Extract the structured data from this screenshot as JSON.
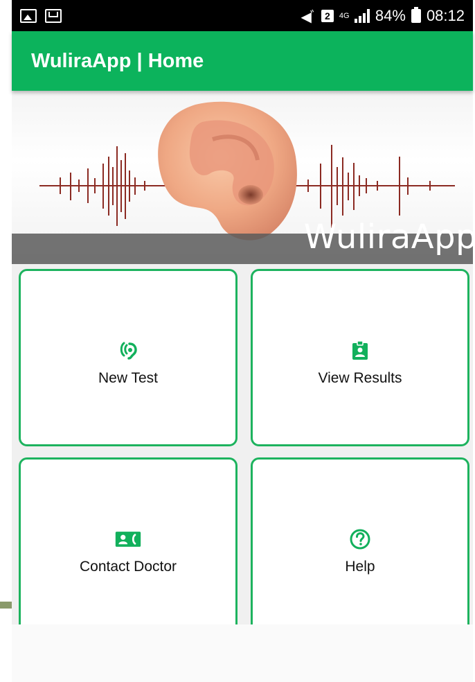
{
  "statusbar": {
    "battery": "84%",
    "time": "08:12",
    "sim_slot": "2",
    "network": "4G",
    "icons": [
      "image-icon",
      "mail-icon",
      "mute-icon",
      "sim-icon",
      "signal-icon",
      "battery-icon"
    ]
  },
  "appbar": {
    "title": "WuliraApp | Home"
  },
  "banner": {
    "label": "WuliraApp",
    "image": "ear-with-sound-waves"
  },
  "menu": {
    "items": [
      {
        "label": "New Test",
        "icon": "ear-hearing-icon"
      },
      {
        "label": "View Results",
        "icon": "contact-badge-icon"
      },
      {
        "label": "Contact Doctor",
        "icon": "contact-phone-icon"
      },
      {
        "label": "Help",
        "icon": "help-circle-icon"
      }
    ]
  },
  "colors": {
    "primary": "#0cb35c",
    "card_border": "#1db35e",
    "icon": "#12b05c",
    "wave": "#8b2a22"
  }
}
